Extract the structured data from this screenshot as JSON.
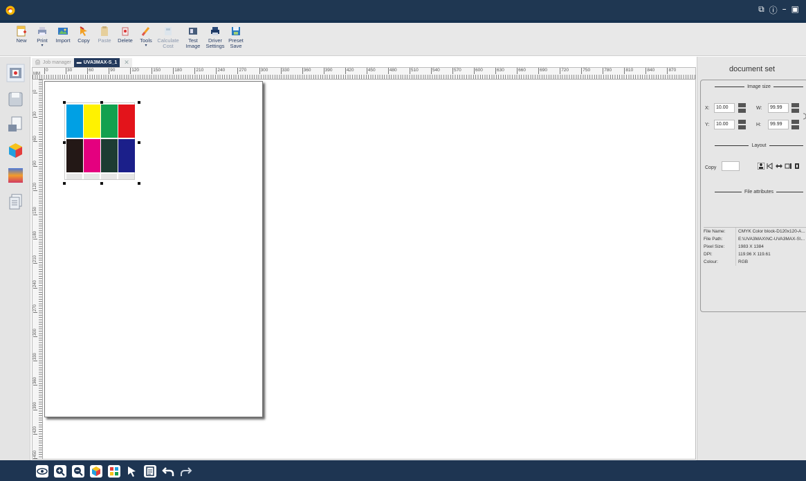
{
  "window": {
    "controls": [
      "restore-icon",
      "help-icon",
      "minimize-icon",
      "window-icon"
    ]
  },
  "toolbar": {
    "items": [
      {
        "label": "New",
        "icon": "new-file-icon",
        "enabled": true,
        "dropdown": false
      },
      {
        "label": "Print",
        "icon": "print-icon",
        "enabled": true,
        "dropdown": true
      },
      {
        "label": "Import",
        "icon": "import-icon",
        "enabled": true,
        "dropdown": false
      },
      {
        "label": "Copy",
        "icon": "copy-icon",
        "enabled": true,
        "dropdown": false
      },
      {
        "label": "Paste",
        "icon": "paste-icon",
        "enabled": false,
        "dropdown": false
      },
      {
        "label": "Delete",
        "icon": "delete-icon",
        "enabled": true,
        "dropdown": false
      },
      {
        "label": "Tools",
        "icon": "tools-icon",
        "enabled": true,
        "dropdown": true
      },
      {
        "label": "Calculate\nCost",
        "icon": "calculate-icon",
        "enabled": false,
        "dropdown": false
      },
      {
        "label": "Test\nImage",
        "icon": "test-image-icon",
        "enabled": true,
        "dropdown": false
      },
      {
        "label": "Driver\nSettings",
        "icon": "driver-settings-icon",
        "enabled": true,
        "dropdown": false
      },
      {
        "label": "Preset\nSave",
        "icon": "preset-save-icon",
        "enabled": true,
        "dropdown": false
      }
    ]
  },
  "tabs": [
    {
      "label": "Job manager",
      "active": false
    },
    {
      "label": "UVA3MAX-S_1",
      "active": true
    }
  ],
  "ruler": {
    "unit": "MM",
    "h_ticks": [
      "0",
      "30",
      "60",
      "90",
      "120",
      "150",
      "180",
      "210",
      "240",
      "270",
      "300",
      "330",
      "360",
      "390",
      "420",
      "450",
      "480",
      "510",
      "540",
      "570",
      "600",
      "630",
      "660",
      "690",
      "720",
      "750",
      "780",
      "810",
      "840",
      "870"
    ],
    "v_ticks": [
      "0",
      "30",
      "60",
      "90",
      "120",
      "150",
      "180",
      "210",
      "240",
      "270",
      "300",
      "330",
      "360",
      "390",
      "420",
      "450"
    ]
  },
  "swatch_colors": {
    "top": [
      "#00a0e4",
      "#fff200",
      "#13a14f",
      "#e3141b"
    ],
    "bottom": [
      "#231816",
      "#e4007f",
      "#1d3c33",
      "#1b1f8a"
    ]
  },
  "panel": {
    "title": "document set",
    "image_size_header": "Image size",
    "x_label": "X:",
    "x_value": "10.00",
    "y_label": "Y:",
    "y_value": "10.00",
    "w_label": "W:",
    "w_value": "99.99",
    "h_label": "H:",
    "h_value": "99.99",
    "layout_header": "Layout",
    "copy_label": "Copy",
    "copy_value": "",
    "file_attr_header": "File attributes",
    "attributes": [
      {
        "key": "File Name:",
        "value": "CMYK Color block-D120x120-A..."
      },
      {
        "key": "File Path:",
        "value": "E:\\UVA3MAX\\NC-UVA3MAX-S\\..."
      },
      {
        "key": "Pixel Size:",
        "value": "1983 X 1384"
      },
      {
        "key": "DPI:",
        "value": "119.96 X 119.61"
      },
      {
        "key": "Colour:",
        "value": "RGB"
      }
    ]
  },
  "bottom_tools": [
    "view-icon",
    "zoom-in-icon",
    "zoom-out-icon",
    "color-cube-icon",
    "grid-color-icon",
    "select-arrow-icon",
    "document-list-icon",
    "undo-icon",
    "redo-icon"
  ]
}
